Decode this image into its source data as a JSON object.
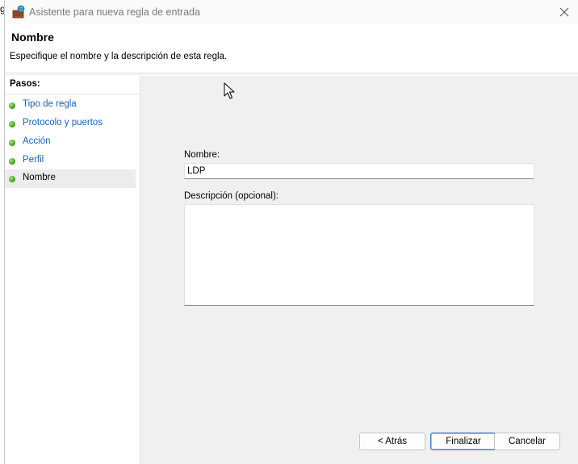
{
  "background": {
    "edge_text": "g"
  },
  "window": {
    "title": "Asistente para nueva regla de entrada",
    "close_icon": "close-icon"
  },
  "header": {
    "title": "Nombre",
    "description": "Especifique el nombre y la descripción de esta regla."
  },
  "sidebar": {
    "heading": "Pasos:",
    "steps": [
      {
        "label": "Tipo de regla",
        "current": false
      },
      {
        "label": "Protocolo y puertos",
        "current": false
      },
      {
        "label": "Acción",
        "current": false
      },
      {
        "label": "Perfil",
        "current": false
      },
      {
        "label": "Nombre",
        "current": true
      }
    ]
  },
  "form": {
    "name_label": "Nombre:",
    "name_value": "LDP",
    "description_label": "Descripción (opcional):",
    "description_value": ""
  },
  "buttons": {
    "back": "< Atrás",
    "finish": "Finalizar",
    "cancel": "Cancelar"
  },
  "colors": {
    "link": "#1a62b8",
    "step_dot": "#4aa31f",
    "content_bg": "#f0f0f0",
    "primary_border": "#3b7bd0"
  }
}
